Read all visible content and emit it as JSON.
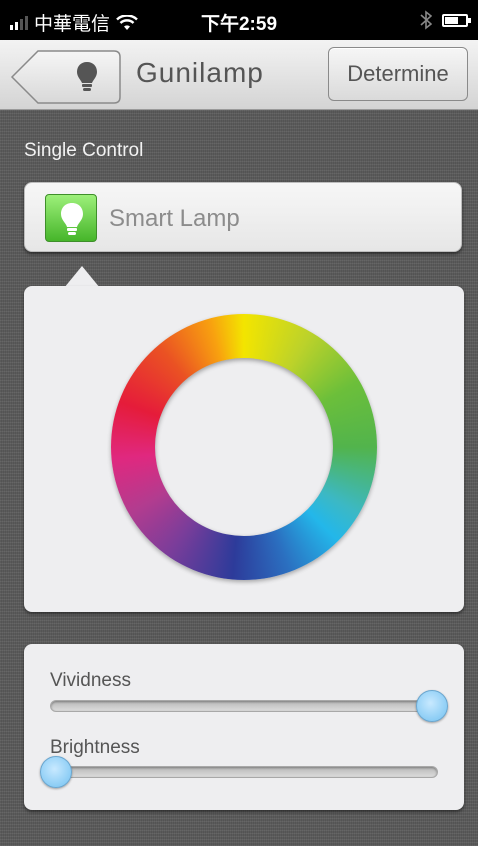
{
  "status_bar": {
    "carrier": "中華電信",
    "time": "下午2:59",
    "icons": [
      "signal-icon",
      "wifi-icon",
      "bluetooth-icon",
      "battery-icon"
    ]
  },
  "nav": {
    "back_icon": "lightbulb-icon",
    "title": "Gunilamp",
    "determine_label": "Determine"
  },
  "section_label": "Single Control",
  "device": {
    "icon": "lamp-icon",
    "name": "Smart Lamp"
  },
  "color_wheel": {
    "icon": "color-wheel"
  },
  "sliders": {
    "vividness": {
      "label": "Vividness",
      "value": 1.0
    },
    "brightness": {
      "label": "Brightness",
      "value": 0.0
    }
  },
  "colors": {
    "accent_thumb": "#8ccdf5",
    "lamp_green": "#46b52a",
    "background": "#5b5b5b"
  }
}
